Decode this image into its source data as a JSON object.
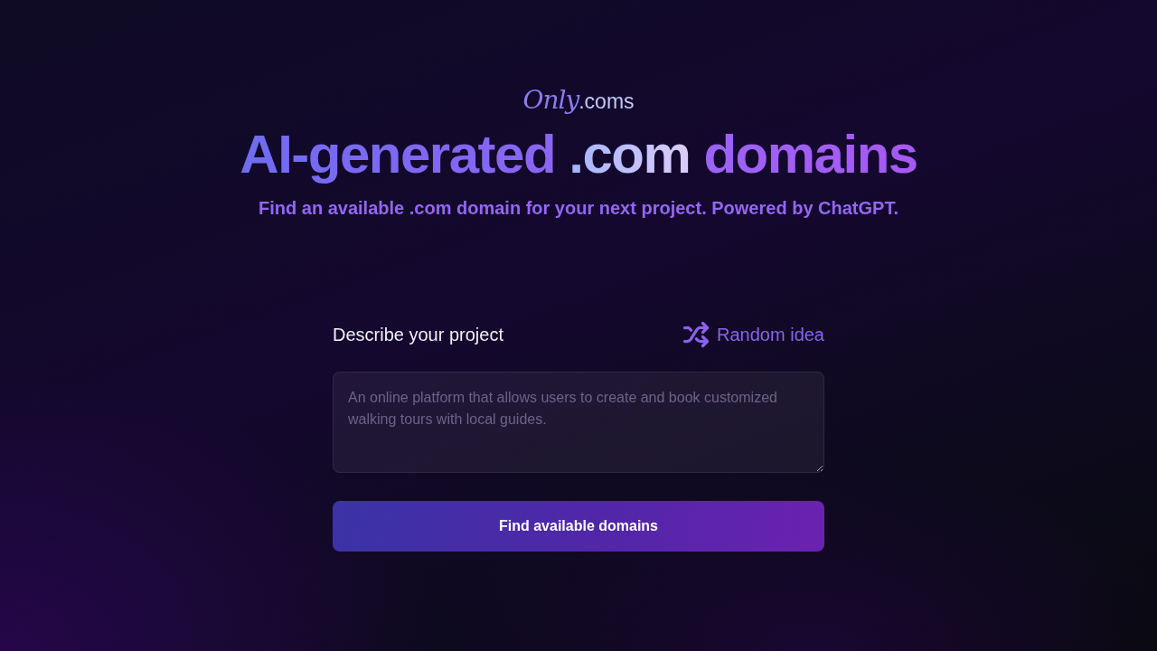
{
  "logo": {
    "script": "Only",
    "suffix": ".coms"
  },
  "headline": {
    "parts": [
      {
        "text": "AI-generated",
        "kind": "indigo"
      },
      {
        "text": ".com",
        "kind": "light"
      },
      {
        "text": "domains",
        "kind": "violet"
      }
    ]
  },
  "tagline": "Find an available .com domain for your next project. Powered by ChatGPT.",
  "form": {
    "label": "Describe your project",
    "random_link": "Random idea",
    "textarea": {
      "placeholder": "An online platform that allows users to create and book customized walking tours with local guides."
    },
    "submit": "Find available domains"
  }
}
